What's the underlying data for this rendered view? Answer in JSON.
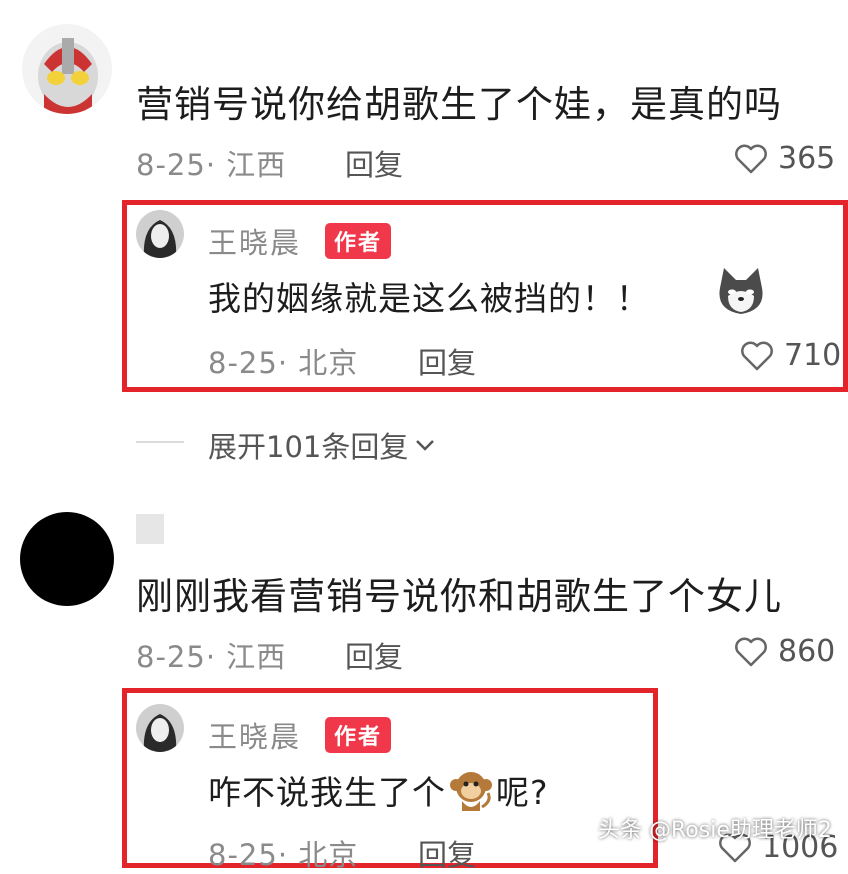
{
  "comments": [
    {
      "text": "营销号说你给胡歌生了个娃，是真的吗",
      "date": "8-25",
      "location": "江西",
      "reply_label": "回复",
      "likes": "365",
      "avatar_icon": "ultraman-avatar-icon",
      "reply": {
        "username": "王晓晨",
        "badge": "作者",
        "text": "我的姻缘就是这么被挡的！！",
        "emoji_icon": "dog-emoji-icon",
        "date": "8-25",
        "location": "北京",
        "reply_label": "回复",
        "likes": "710"
      }
    },
    {
      "text": "刚刚我看营销号说你和胡歌生了个女儿",
      "date": "8-25",
      "location": "江西",
      "reply_label": "回复",
      "likes": "860",
      "avatar_icon": "black-circle-avatar-icon",
      "reply": {
        "username": "王晓晨",
        "badge": "作者",
        "text_before": "咋不说我生了个",
        "emoji_icon": "monkey-emoji-icon",
        "text_after": "呢?",
        "date": "8-25",
        "location": "北京",
        "reply_label": "回复",
        "likes": "1006"
      }
    }
  ],
  "expand": {
    "label": "展开101条回复"
  },
  "watermark": "头条 @Rosie助理老师2",
  "colors": {
    "highlight_border": "#e3242b",
    "author_badge": "#f0384a",
    "meta_text": "#8a8a8a"
  }
}
